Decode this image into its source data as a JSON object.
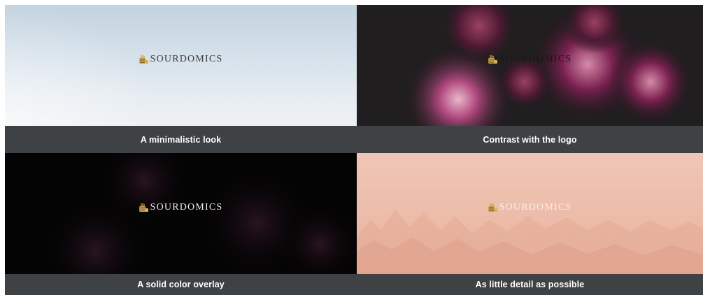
{
  "brand": {
    "name": "SOURDOMICS",
    "logo_icon": "bread-loaf-icon",
    "logo_color": "#c9a04a"
  },
  "cards": [
    {
      "caption": "A minimalistic look",
      "background": "sky-gradient"
    },
    {
      "caption": "Contrast with the logo",
      "background": "dark-flowers"
    },
    {
      "caption": "A solid color overlay",
      "background": "black-overlay-flowers"
    },
    {
      "caption": "As little detail as possible",
      "background": "peach-misty-trees"
    }
  ],
  "colors": {
    "caption_bar": "#3e4245",
    "caption_text": "#ffffff",
    "flower_accent": "#7a2a55"
  }
}
